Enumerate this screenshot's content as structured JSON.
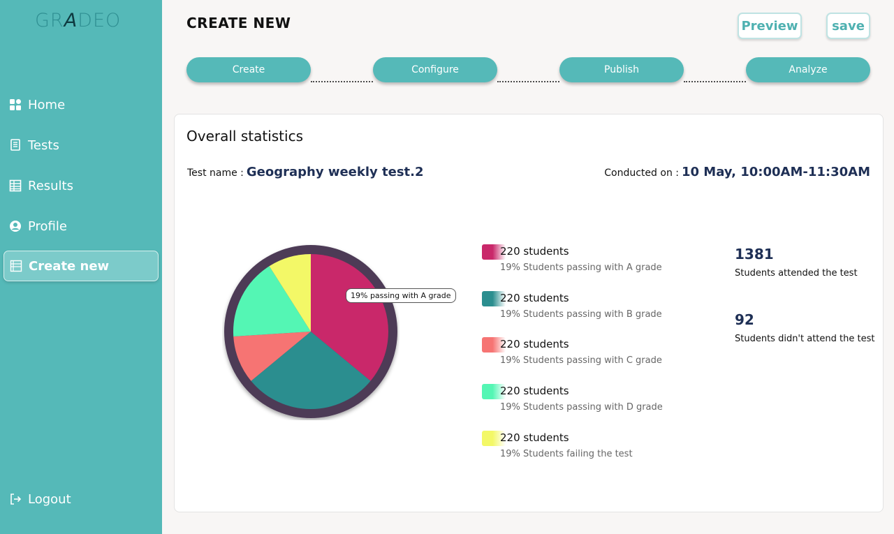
{
  "app": {
    "logo_left": "GR",
    "logo_mid": "A",
    "logo_right": "DEO"
  },
  "sidebar": {
    "items": [
      {
        "label": "Home",
        "icon": "grid-icon"
      },
      {
        "label": "Tests",
        "icon": "document-icon"
      },
      {
        "label": "Results",
        "icon": "table-icon"
      },
      {
        "label": "Profile",
        "icon": "user-circle-icon"
      },
      {
        "label": "Create new",
        "icon": "list-icon"
      }
    ],
    "logout": "Logout"
  },
  "header": {
    "title": "CREATE NEW",
    "preview_label": "Preview",
    "save_label": "save"
  },
  "steps": [
    "Create",
    "Configure",
    "Publish",
    "Analyze"
  ],
  "card": {
    "title": "Overall statistics",
    "test_name_label": "Test name :",
    "test_name": "Geography weekly test.2",
    "conducted_label": "Conducted on :",
    "conducted_value": "10 May,  10:00AM-11:30AM"
  },
  "chart_data": {
    "type": "pie",
    "tooltip": "19% passing with A grade",
    "slices": [
      {
        "label": "A grade",
        "value": 36,
        "color": "#c9286a"
      },
      {
        "label": "B grade",
        "value": 28,
        "color": "#2b8e8f"
      },
      {
        "label": "C grade",
        "value": 10,
        "color": "#f67473"
      },
      {
        "label": "D grade",
        "value": 17,
        "color": "#54f6b4"
      },
      {
        "label": "Failing",
        "value": 9,
        "color": "#f3f867"
      }
    ],
    "ring_color": "#4d3b57"
  },
  "legend": [
    {
      "count": "220 students",
      "desc": "19% Students passing with A grade",
      "color": "#c9286a"
    },
    {
      "count": "220 students",
      "desc": "19% Students passing with B grade",
      "color": "#2b8e8f"
    },
    {
      "count": "220 students",
      "desc": "19% Students passing with C grade",
      "color": "#f67473"
    },
    {
      "count": "220 students",
      "desc": "19% Students passing with D grade",
      "color": "#54f6b4"
    },
    {
      "count": "220 students",
      "desc": "19% Students failing the test",
      "color": "#f3f867"
    }
  ],
  "stats": [
    {
      "value": "1381",
      "label": "Students attended the test"
    },
    {
      "value": "92",
      "label": "Students didn't attend the test"
    }
  ]
}
